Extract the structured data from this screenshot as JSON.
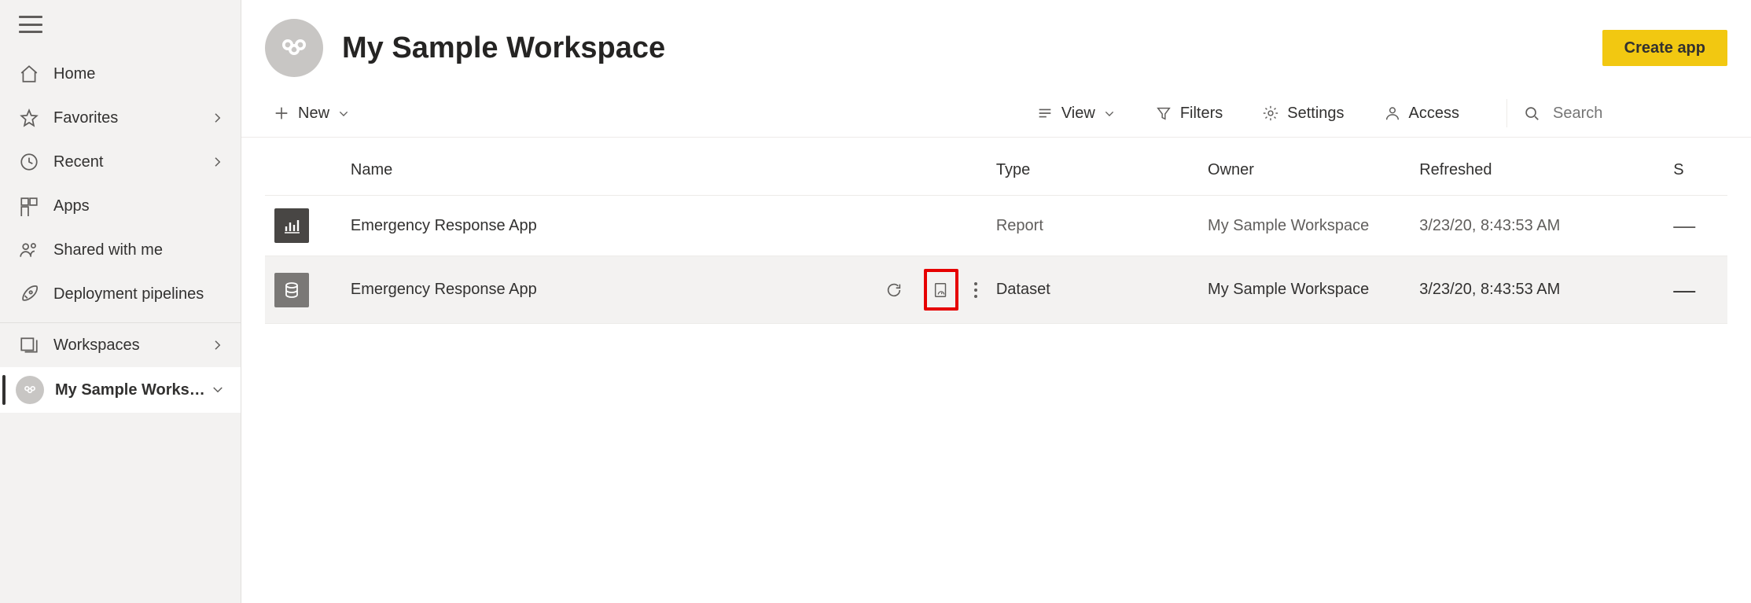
{
  "sidebar": {
    "items": [
      {
        "label": "Home"
      },
      {
        "label": "Favorites"
      },
      {
        "label": "Recent"
      },
      {
        "label": "Apps"
      },
      {
        "label": "Shared with me"
      },
      {
        "label": "Deployment pipelines"
      }
    ],
    "workspaces_label": "Workspaces",
    "current_workspace": "My Sample Works…"
  },
  "header": {
    "title": "My Sample Workspace",
    "create_label": "Create app"
  },
  "toolbar": {
    "new_label": "New",
    "view_label": "View",
    "filters_label": "Filters",
    "settings_label": "Settings",
    "access_label": "Access",
    "search_placeholder": "Search"
  },
  "table": {
    "headers": {
      "name": "Name",
      "type": "Type",
      "owner": "Owner",
      "refreshed": "Refreshed",
      "sensitivity": "S"
    },
    "rows": [
      {
        "icon": "report",
        "name": "Emergency Response App",
        "type": "Report",
        "owner": "My Sample Workspace",
        "refreshed": "3/23/20, 8:43:53 AM",
        "sensitivity": "—"
      },
      {
        "icon": "dataset",
        "name": "Emergency Response App",
        "type": "Dataset",
        "owner": "My Sample Workspace",
        "refreshed": "3/23/20, 8:43:53 AM",
        "sensitivity": "—"
      }
    ]
  }
}
